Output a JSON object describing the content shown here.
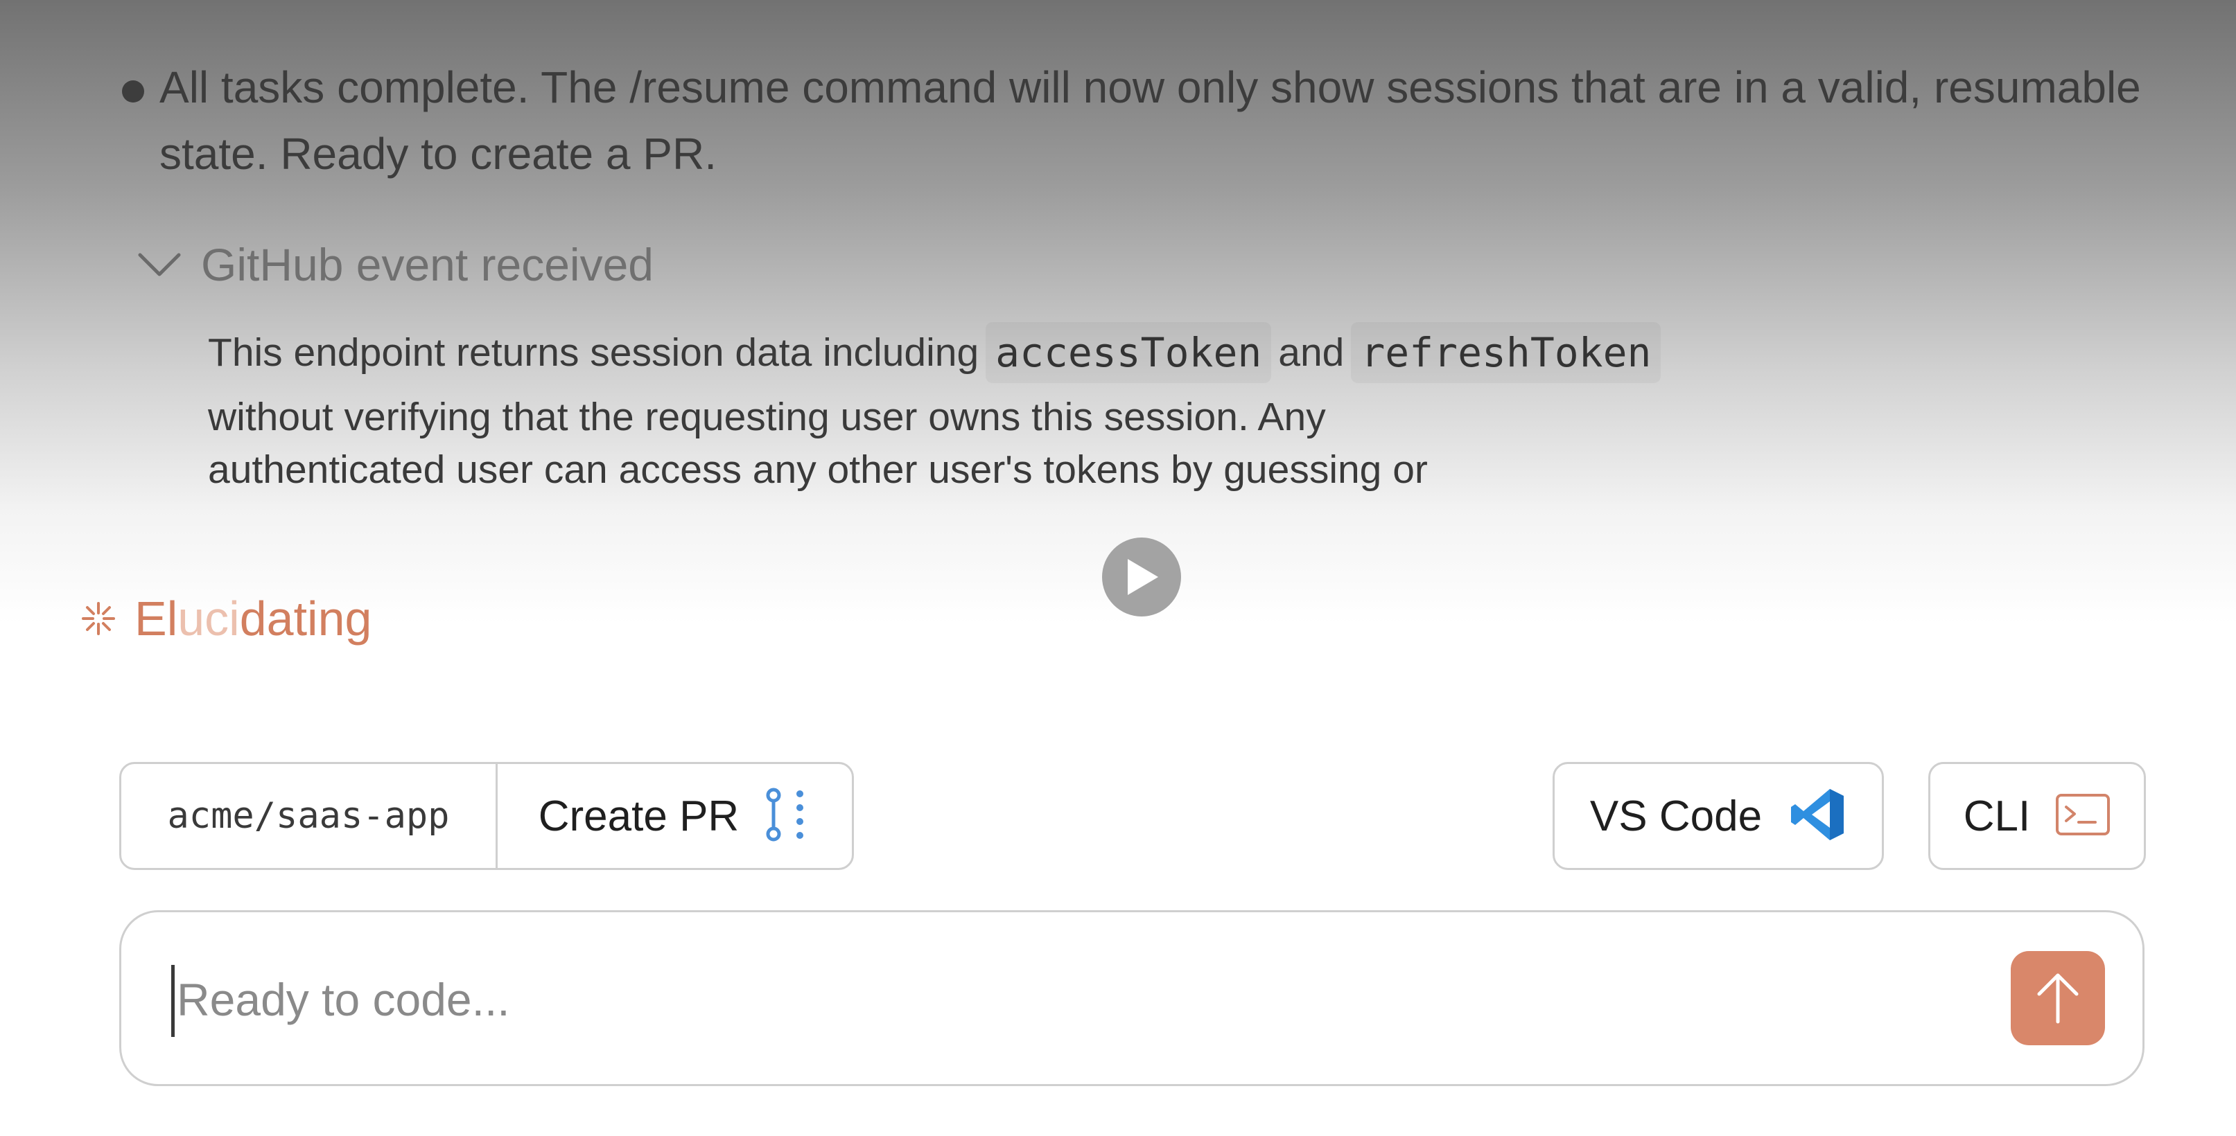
{
  "message": {
    "bullet_text": "All tasks complete. The /resume command will now only show sessions that are in a valid, resumable state. Ready to create a PR."
  },
  "event": {
    "title": "GitHub event received",
    "body_prefix": "This endpoint returns session data including",
    "code_1": "accessToken",
    "conjunction": "and",
    "code_2": "refreshToken",
    "body_line_2": "without verifying that the requesting user owns this session. Any",
    "body_line_3": "authenticated user can access any other user's tokens by guessing or"
  },
  "status": {
    "icon": "asterisk-spinner-icon",
    "text_part_1": "El",
    "text_part_highlight": "uci",
    "text_part_2": "dating",
    "color": "#d27f5f"
  },
  "toolbar": {
    "repo_name": "acme/saas-app",
    "create_pr_label": "Create PR",
    "create_pr_icon": "git-pull-request-icon",
    "vscode_label": "VS Code",
    "vscode_icon": "vscode-logo-icon",
    "cli_label": "CLI",
    "cli_icon": "terminal-icon"
  },
  "input": {
    "placeholder": "Ready to code...",
    "value": ""
  },
  "colors": {
    "accent": "#d9876a",
    "pr_icon": "#4a8fd9",
    "vscode_blue": "#2f8fe0"
  }
}
